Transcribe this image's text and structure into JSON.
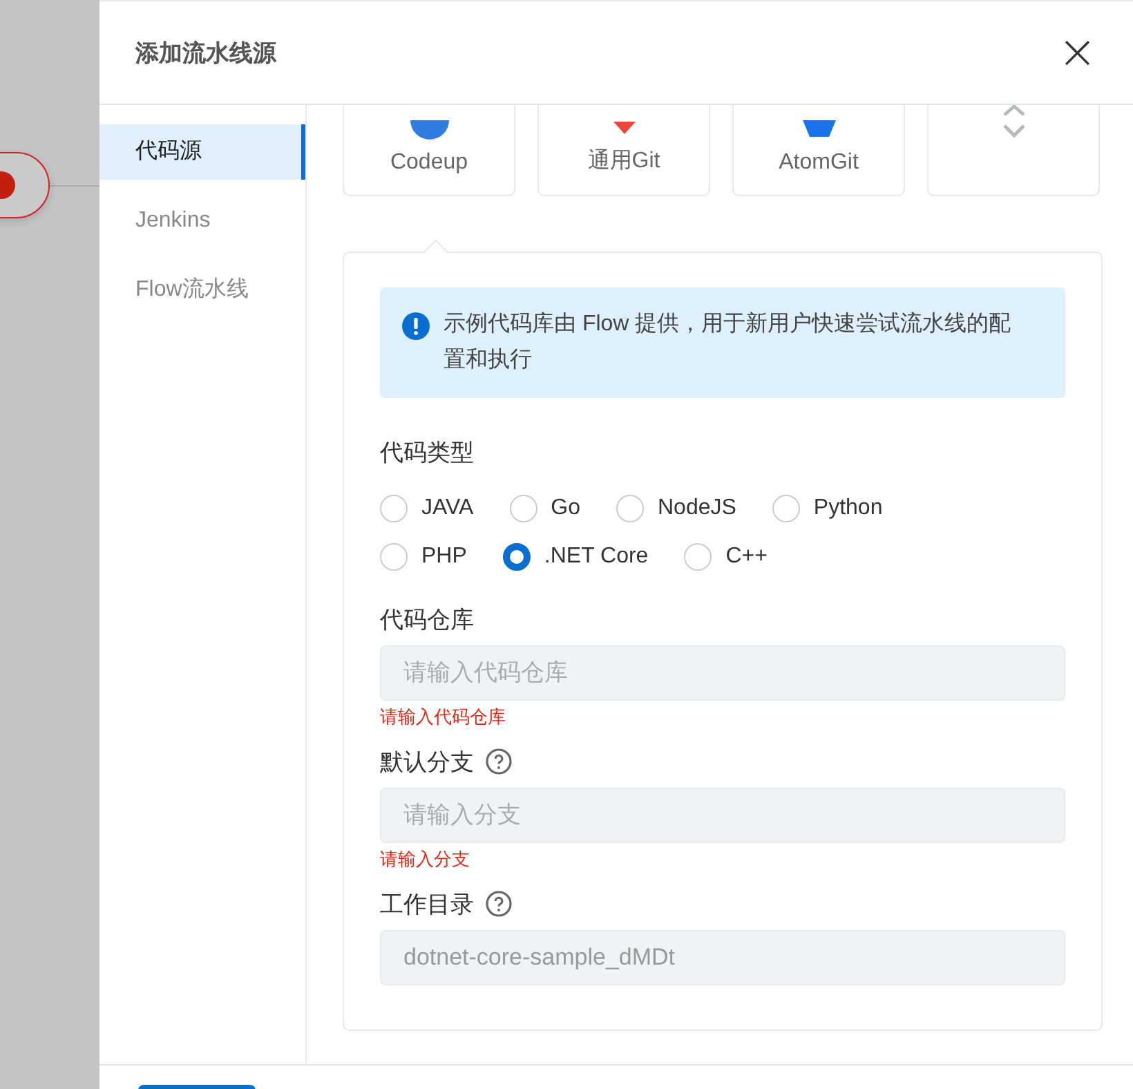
{
  "drawer": {
    "title": "添加流水线源",
    "close": "×"
  },
  "nav": [
    {
      "label": "代码源",
      "selected": true
    },
    {
      "label": "Jenkins",
      "selected": false
    },
    {
      "label": "Flow流水线",
      "selected": false
    }
  ],
  "sources": [
    {
      "label": "Codeup",
      "kind": "codeup"
    },
    {
      "label": "通用Git",
      "kind": "git"
    },
    {
      "label": "AtomGit",
      "kind": "atomgit"
    },
    {
      "kind": "expand"
    }
  ],
  "notice": "示例代码库由 Flow 提供，用于新用户快速尝试流水线的配置和执行",
  "code_type": {
    "label": "代码类型",
    "options": [
      {
        "label": "JAVA",
        "selected": false
      },
      {
        "label": "Go",
        "selected": false
      },
      {
        "label": "NodeJS",
        "selected": false
      },
      {
        "label": "Python",
        "selected": false
      },
      {
        "label": "PHP",
        "selected": false
      },
      {
        "label": ".NET Core",
        "selected": true
      },
      {
        "label": "C++",
        "selected": false
      }
    ]
  },
  "fields": [
    {
      "label": "代码仓库",
      "help": false,
      "placeholder": "请输入代码仓库",
      "error": "请输入代码仓库"
    },
    {
      "label": "默认分支",
      "help": true,
      "placeholder": "请输入分支",
      "error": "请输入分支"
    },
    {
      "label": "工作目录",
      "help": true,
      "value": "dotnet-core-sample_dMDt"
    }
  ]
}
